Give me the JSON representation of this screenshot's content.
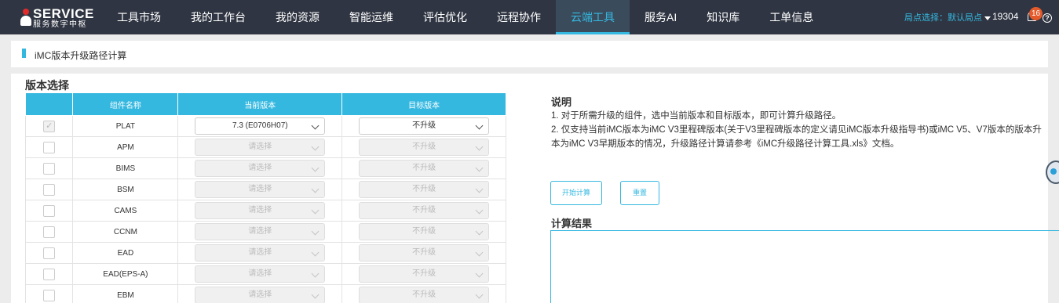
{
  "header": {
    "logo_text": "SERVICE",
    "logo_sub": "服务数字中枢",
    "nav": [
      "工具市场",
      "我的工作台",
      "我的资源",
      "智能运维",
      "评估优化",
      "远程协作",
      "云端工具",
      "服务AI",
      "知识库",
      "工单信息"
    ],
    "active_nav": "云端工具",
    "site_selector": "局点选择：默认局点",
    "user_id": "19304",
    "notification_count": "16",
    "help_icon": "?"
  },
  "page": {
    "title": "iMC版本升级路径计算"
  },
  "version_select": {
    "title": "版本选择",
    "columns": [
      "组件名称",
      "当前版本",
      "目标版本"
    ],
    "rows": [
      {
        "checked": true,
        "name": "PLAT",
        "current": "7.3 (E0706H07)",
        "target": "不升级",
        "enabled": true
      },
      {
        "checked": false,
        "name": "APM",
        "current": "请选择",
        "target": "不升级",
        "enabled": false
      },
      {
        "checked": false,
        "name": "BIMS",
        "current": "请选择",
        "target": "不升级",
        "enabled": false
      },
      {
        "checked": false,
        "name": "BSM",
        "current": "请选择",
        "target": "不升级",
        "enabled": false
      },
      {
        "checked": false,
        "name": "CAMS",
        "current": "请选择",
        "target": "不升级",
        "enabled": false
      },
      {
        "checked": false,
        "name": "CCNM",
        "current": "请选择",
        "target": "不升级",
        "enabled": false
      },
      {
        "checked": false,
        "name": "EAD",
        "current": "请选择",
        "target": "不升级",
        "enabled": false
      },
      {
        "checked": false,
        "name": "EAD(EPS-A)",
        "current": "请选择",
        "target": "不升级",
        "enabled": false
      },
      {
        "checked": false,
        "name": "EBM",
        "current": "请选择",
        "target": "不升级",
        "enabled": false
      }
    ]
  },
  "notes": {
    "title": "说明",
    "line1": "1. 对于所需升级的组件，选中当前版本和目标版本，即可计算升级路径。",
    "line2": "2. 仅支持当前iMC版本为iMC V3里程碑版本(关于V3里程碑版本的定义请见iMC版本升级指导书)或iMC V5、V7版本的版本升",
    "line3": "本为iMC V3早期版本的情况，升级路径计算请参考《iMC升级路径计算工具.xls》文档。"
  },
  "actions": {
    "calculate": "开始计算",
    "reset": "重置"
  },
  "result": {
    "title": "计算结果"
  }
}
